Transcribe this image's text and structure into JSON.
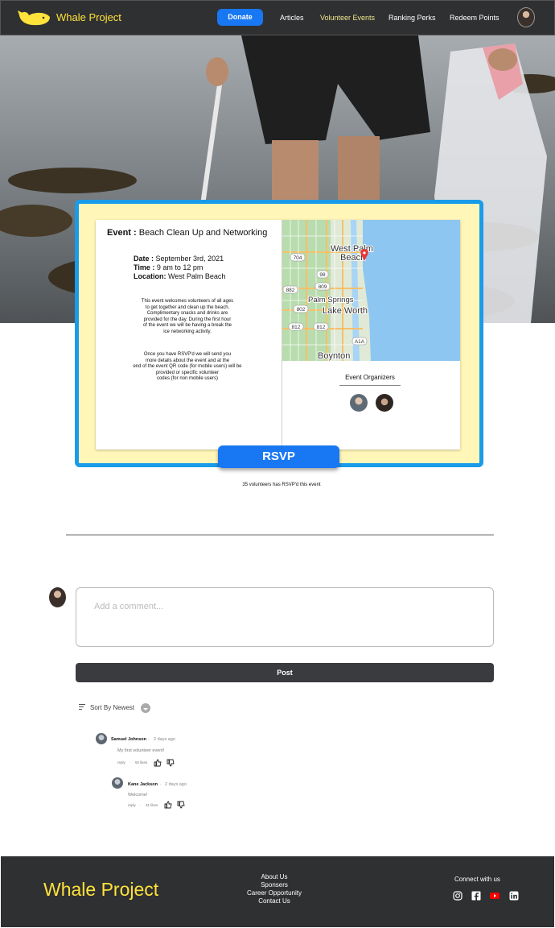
{
  "header": {
    "brand": "Whale Project",
    "donate_label": "Donate",
    "nav": [
      "Articles",
      "Volunteer Events",
      "Ranking Perks",
      "Redeem Points"
    ],
    "active_nav": "Volunteer Events"
  },
  "event": {
    "title_prefix": "Event :",
    "title": "Beach Clean Up and Networking",
    "date_label": "Date :",
    "date": "September 3rd, 2021",
    "time_label": "Time :",
    "time": "9 am to 12 pm",
    "location_label": "Location:",
    "location": "West Palm Beach",
    "description": [
      "This event welcomes volunteers of all ages",
      "to get together and clean up the beach.",
      "Complimentary snacks and drinks are",
      "provided for the day. During the first hour",
      "of the event we will be having a break the",
      "ice networking activity."
    ],
    "description2": [
      "Once you have RSVP'd we will send you",
      "more details about the event and at the",
      "end of the event QR code (for mobile users) will be",
      "provided or specific volunteer",
      "codes (for non mobile users)"
    ],
    "organizers_label": "Event Organizers",
    "rsvp_label": "RSVP",
    "rsvp_count_text": "35 volunteers has RSVP'd this event"
  },
  "map": {
    "labels": {
      "west_palm": "West Palm",
      "beach": "Beach",
      "palm_springs": "Palm Springs",
      "lake_worth": "Lake Worth",
      "boynton": "Boynton"
    },
    "routes": [
      "704",
      "98",
      "809",
      "882",
      "802",
      "812",
      "812",
      "A1A"
    ]
  },
  "comments": {
    "placeholder": "Add a comment...",
    "post_label": "Post",
    "sort_label": "Sort By Newest",
    "items": [
      {
        "name": "Samuel Johnson",
        "time": "2 days ago",
        "text": "My first volunteer event!",
        "reply": "reply",
        "likes": "50 likes"
      },
      {
        "name": "Kane Jackson",
        "time": "2 days ago",
        "text": "Welcome!",
        "reply": "reply",
        "likes": "31 likes"
      }
    ]
  },
  "footer": {
    "brand": "Whale Project",
    "links": [
      "About Us",
      "Sponsers",
      "Career Opportunity",
      "Contact Us"
    ],
    "connect": "Connect with us",
    "social_icons": [
      "instagram-icon",
      "facebook-icon",
      "youtube-icon",
      "linkedin-icon"
    ]
  },
  "colors": {
    "brand_yellow": "#ffe23a",
    "primary_blue": "#1877f2",
    "card_border": "#1a9bea",
    "card_bg": "#fff6b8",
    "dark": "#2f3032"
  }
}
